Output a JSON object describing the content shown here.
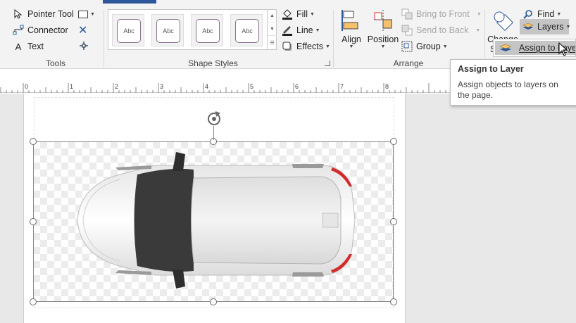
{
  "tools": {
    "pointer_tool": "Pointer Tool",
    "connector": "Connector",
    "text": "Text",
    "group_label": "Tools"
  },
  "shape_styles": {
    "items": [
      "Abc",
      "Abc",
      "Abc",
      "Abc"
    ],
    "fill": "Fill",
    "line": "Line",
    "effects": "Effects",
    "group_label": "Shape Styles"
  },
  "arrange": {
    "align": "Align",
    "position": "Position",
    "bring_to_front": "Bring to Front",
    "send_to_back": "Send to Back",
    "group": "Group",
    "group_label": "Arrange"
  },
  "editing": {
    "change_shape_line1": "Change",
    "change_shape_line2": "S",
    "find": "Find",
    "layers": "Layers",
    "assign_to_layer": "Assign to Layer..."
  },
  "tooltip": {
    "title": "Assign to Layer",
    "body": "Assign objects to layers on the page."
  },
  "ruler": {
    "numbers": [
      "0",
      "1",
      "2",
      "3",
      "4",
      "5",
      "6",
      "7",
      "8"
    ]
  },
  "colors": {
    "accent": "#2b579a",
    "ribbon_bg": "#f3f3f3",
    "highlight": "#c5c5c5",
    "car_red": "#d42a2a",
    "car_dark": "#3a3a3a"
  },
  "icons": {
    "pointer": "pointer-icon",
    "connector": "connector-icon",
    "text": "text-icon",
    "rectangle": "rectangle-icon",
    "close": "close-x-icon",
    "connection_point": "connection-point-icon",
    "fill": "fill-bucket-icon",
    "line": "line-pen-icon",
    "effects": "effects-icon",
    "align": "align-icon",
    "position": "position-icon",
    "bring_front": "bring-to-front-icon",
    "send_back": "send-to-back-icon",
    "group": "group-icon",
    "change_shape": "change-shape-icon",
    "find": "find-icon",
    "layers": "layers-icon",
    "rotate": "rotate-handle-icon"
  }
}
